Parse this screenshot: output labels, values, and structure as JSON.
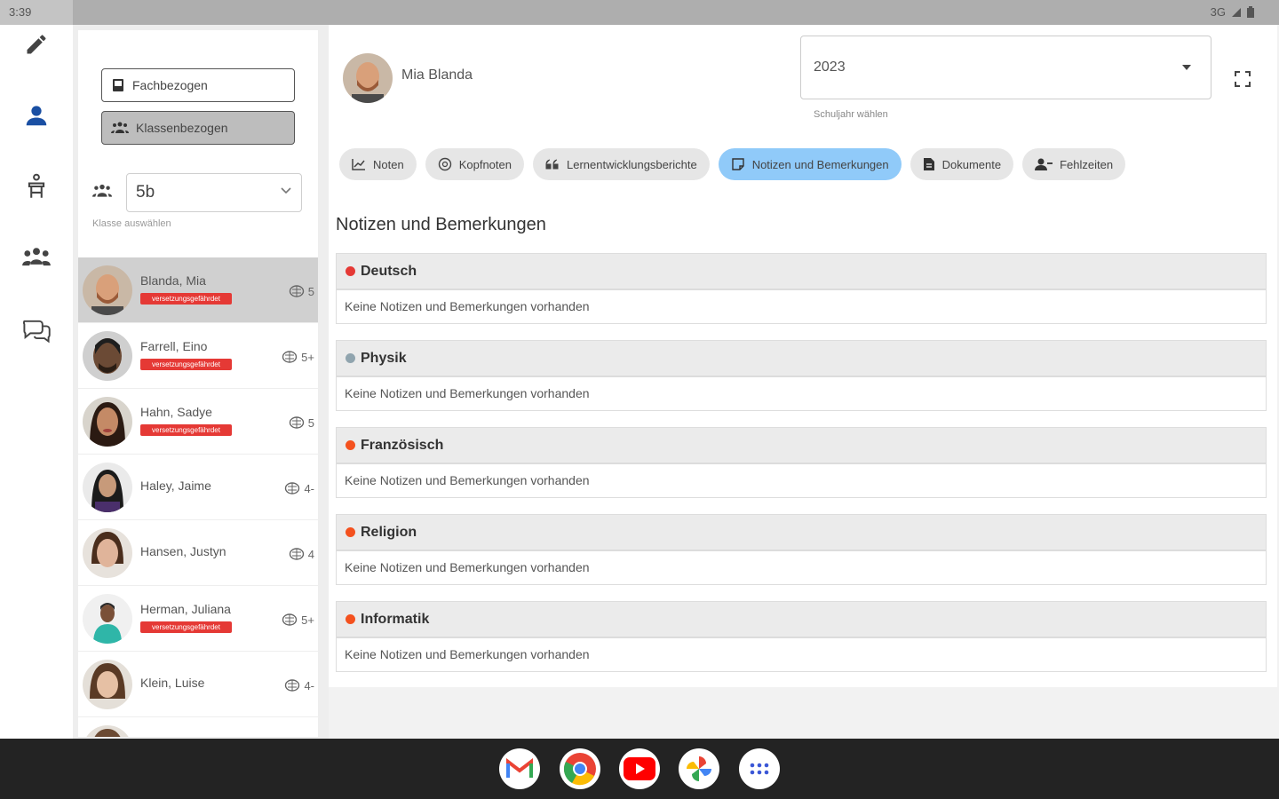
{
  "status": {
    "time": "3:39",
    "network": "3G"
  },
  "sidebar_modes": {
    "subject_based": "Fachbezogen",
    "class_based": "Klassenbezogen"
  },
  "class_selector": {
    "value": "5b",
    "hint": "Klasse auswählen"
  },
  "students": [
    {
      "name": "Blanda, Mia",
      "badge": "versetzungsgefährdet",
      "grade": "5",
      "selected": true
    },
    {
      "name": "Farrell, Eino",
      "badge": "versetzungsgefährdet",
      "grade": "5+"
    },
    {
      "name": "Hahn, Sadye",
      "badge": "versetzungsgefährdet",
      "grade": "5"
    },
    {
      "name": "Haley, Jaime",
      "badge": "",
      "grade": "4-"
    },
    {
      "name": "Hansen, Justyn",
      "badge": "",
      "grade": "4"
    },
    {
      "name": "Herman, Juliana",
      "badge": "versetzungsgefährdet",
      "grade": "5+"
    },
    {
      "name": "Klein, Luise",
      "badge": "",
      "grade": "4-"
    }
  ],
  "header": {
    "student_name": "Mia Blanda",
    "year_value": "2023",
    "year_hint": "Schuljahr wählen"
  },
  "tabs": [
    {
      "label": "Noten",
      "icon": "chart-icon"
    },
    {
      "label": "Kopfnoten",
      "icon": "badge-icon"
    },
    {
      "label": "Lernentwicklungsberichte",
      "icon": "quote-icon"
    },
    {
      "label": "Notizen und Bemerkungen",
      "icon": "note-icon",
      "active": true
    },
    {
      "label": "Dokumente",
      "icon": "document-icon"
    },
    {
      "label": "Fehlzeiten",
      "icon": "person-absent-icon"
    }
  ],
  "section_title": "Notizen und Bemerkungen",
  "subjects": [
    {
      "name": "Deutsch",
      "color": "#e53935",
      "text": "Keine Notizen und Bemerkungen vorhanden"
    },
    {
      "name": "Physik",
      "color": "#90a4ae",
      "text": "Keine Notizen und Bemerkungen vorhanden"
    },
    {
      "name": "Französisch",
      "color": "#f4511e",
      "text": "Keine Notizen und Bemerkungen vorhanden"
    },
    {
      "name": "Religion",
      "color": "#f4511e",
      "text": "Keine Notizen und Bemerkungen vorhanden"
    },
    {
      "name": "Informatik",
      "color": "#f4511e",
      "text": "Keine Notizen und Bemerkungen vorhanden"
    }
  ],
  "dock_apps": [
    "gmail-icon",
    "chrome-icon",
    "youtube-icon",
    "photos-icon",
    "app-drawer-icon"
  ]
}
